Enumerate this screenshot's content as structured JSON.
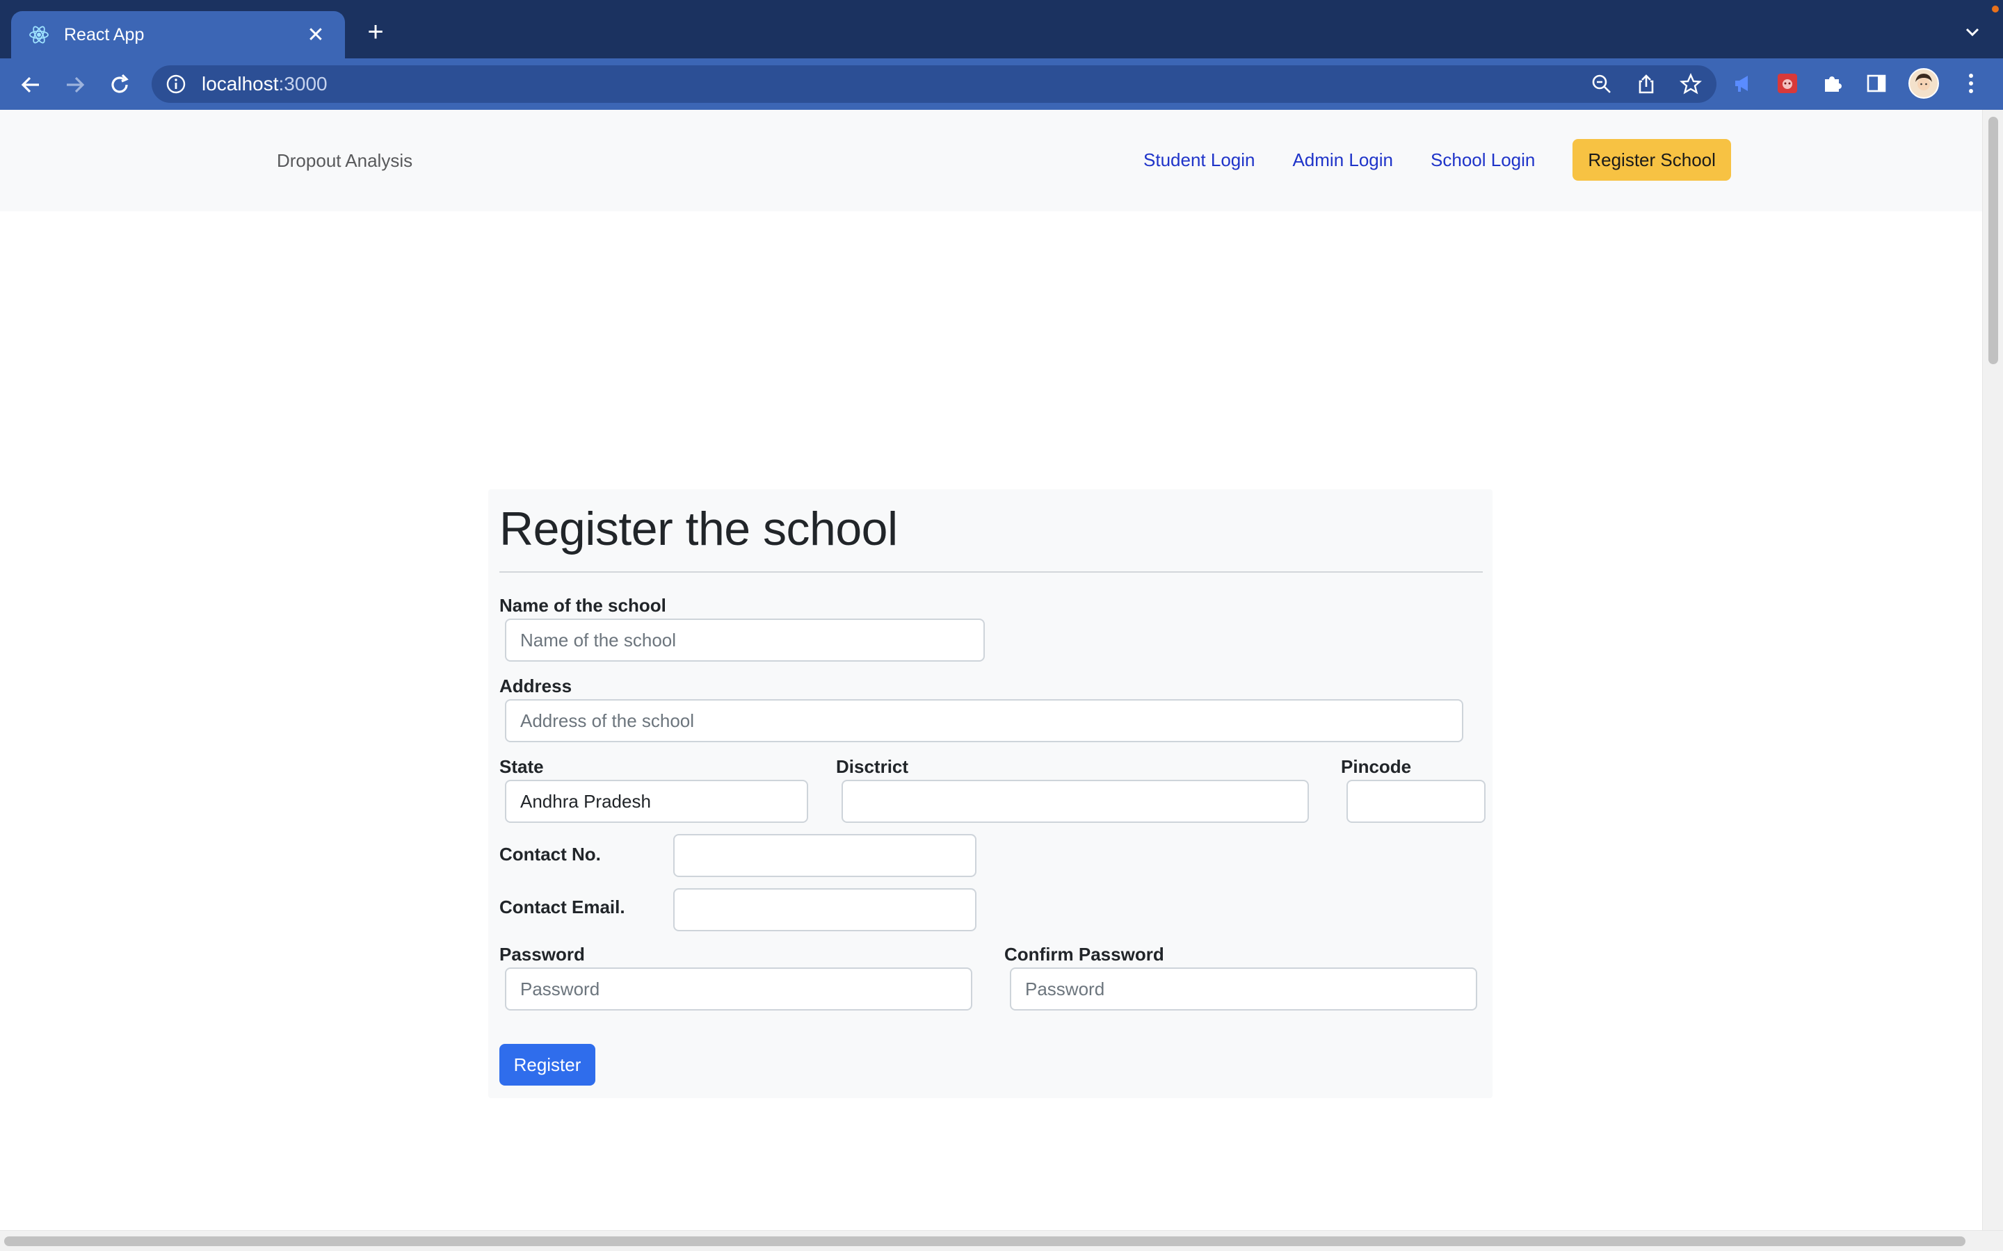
{
  "browser": {
    "tab_title": "React App",
    "url_host": "localhost",
    "url_port": ":3000",
    "tab_close_glyph": "✕",
    "new_tab_glyph": "+"
  },
  "icons": {
    "favicon": "react-logo-icon",
    "back": "arrow-left-icon",
    "forward": "arrow-right-icon",
    "reload": "reload-icon",
    "site_info": "info-icon",
    "zoom": "zoom-out-icon",
    "share": "share-icon",
    "bookmark": "star-icon",
    "extensions": "puzzle-icon",
    "side_panel": "side-panel-icon",
    "menu": "kebab-menu-icon"
  },
  "colors": {
    "tab_bar": "#1b3260",
    "toolbar": "#3c66b5",
    "nav_link": "#1f34c9",
    "cta": "#f7c243",
    "primary_button": "#2f6dec"
  },
  "navbar": {
    "brand": "Dropout Analysis",
    "links": [
      "Student Login",
      "Admin Login",
      "School Login"
    ],
    "cta": "Register School"
  },
  "form": {
    "title": "Register the school",
    "name_label": "Name of the school",
    "name_placeholder": "Name of the school",
    "address_label": "Address",
    "address_placeholder": "Address of the school",
    "state_label": "State",
    "state_value": "Andhra Pradesh",
    "district_label": "Disctrict",
    "pincode_label": "Pincode",
    "contact_no_label": "Contact No.",
    "contact_email_label": "Contact Email.",
    "password_label": "Password",
    "password_placeholder": "Password",
    "confirm_password_label": "Confirm Password",
    "confirm_password_placeholder": "Password",
    "submit": "Register"
  }
}
